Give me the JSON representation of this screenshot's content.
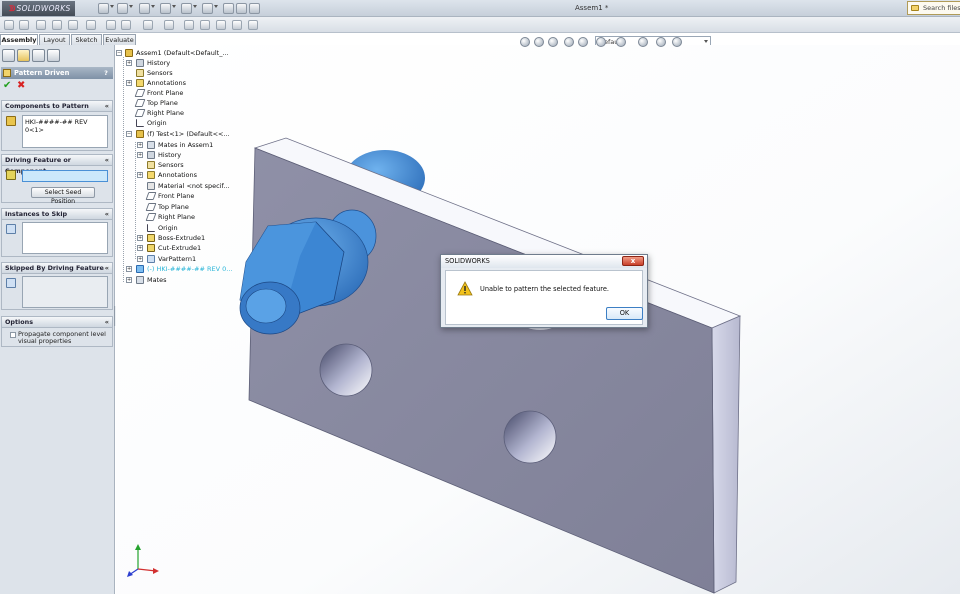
{
  "app": {
    "brand": "SOLIDWORKS",
    "document_title": "Assem1 *",
    "search_placeholder": "Search files a",
    "configuration": "Default"
  },
  "command_tabs": [
    "Assembly",
    "Layout",
    "Sketch",
    "Evaluate"
  ],
  "property_manager": {
    "title": "Pattern Driven",
    "help": "?",
    "ok_symbol": "✔",
    "cancel_symbol": "✖",
    "groups": {
      "components": {
        "title": "Components to Pattern",
        "items": [
          "HKI-####-## REV 0<1>"
        ]
      },
      "driving": {
        "title": "Driving Feature or Component",
        "seed_button": "Select Seed Position"
      },
      "skip": {
        "title": "Instances to Skip"
      },
      "skipped": {
        "title": "Skipped By Driving Feature"
      },
      "options": {
        "title": "Options",
        "propagate_line1": "Propagate component level",
        "propagate_line2": "visual properties"
      }
    }
  },
  "tree": {
    "root": "Assem1  (Default<Default_...",
    "items": [
      {
        "label": "History"
      },
      {
        "label": "Sensors"
      },
      {
        "label": "Annotations"
      },
      {
        "label": "Front Plane"
      },
      {
        "label": "Top Plane"
      },
      {
        "label": "Right Plane"
      },
      {
        "label": "Origin"
      },
      {
        "label": "(f) Test<1> (Default<<..."
      },
      {
        "label": "Mates in Assem1"
      },
      {
        "label": "History"
      },
      {
        "label": "Sensors"
      },
      {
        "label": "Annotations"
      },
      {
        "label": "Material <not specif..."
      },
      {
        "label": "Front Plane"
      },
      {
        "label": "Top Plane"
      },
      {
        "label": "Right Plane"
      },
      {
        "label": "Origin"
      },
      {
        "label": "Boss-Extrude1"
      },
      {
        "label": "Cut-Extrude1"
      },
      {
        "label": "VarPattern1"
      },
      {
        "label": "(-) HKI-####-## REV 0..."
      },
      {
        "label": "Mates"
      }
    ]
  },
  "dialog": {
    "title": "SOLIDWORKS",
    "close": "x",
    "message": "Unable to pattern the selected feature.",
    "ok": "OK"
  },
  "colors": {
    "part_body": "#8e8fa5",
    "fastener": "#3b85d6",
    "accent": "#3c7fc4"
  }
}
